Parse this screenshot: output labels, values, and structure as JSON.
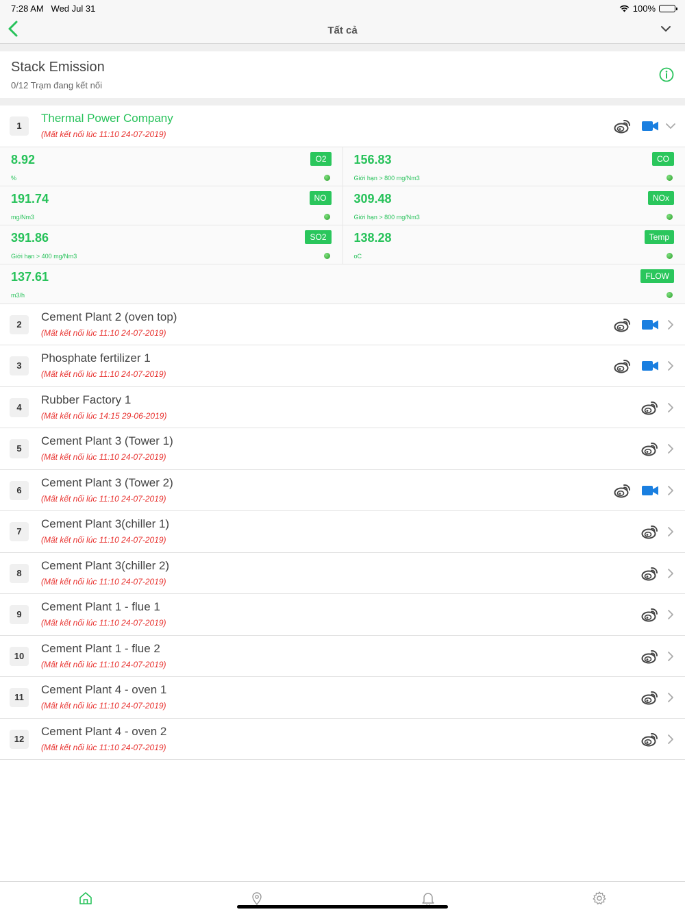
{
  "status_bar": {
    "time": "7:28 AM",
    "date": "Wed Jul 31",
    "battery": "100%"
  },
  "nav": {
    "title": "Tất cả",
    "back_icon": "chevron-left-icon",
    "dropdown_icon": "chevron-down-icon"
  },
  "header": {
    "title": "Stack Emission",
    "subtitle": "0/12 Trạm đang kết nối"
  },
  "colors": {
    "accent": "#27c25a",
    "error": "#e8322f",
    "video": "#1a7fe0"
  },
  "stations": [
    {
      "num": "1",
      "name": "Thermal Power Company",
      "status": "(Mất kết nối lúc  11:10 24-07-2019)",
      "camera": true,
      "expanded": true
    },
    {
      "num": "2",
      "name": "Cement Plant 2 (oven top)",
      "status": "(Mất kết nối lúc  11:10 24-07-2019)",
      "camera": true
    },
    {
      "num": "3",
      "name": "Phosphate fertilizer 1",
      "status": "(Mất kết nối lúc  11:10 24-07-2019)",
      "camera": true
    },
    {
      "num": "4",
      "name": "Rubber Factory 1",
      "status": "(Mất kết nối lúc  14:15 29-06-2019)",
      "camera": false
    },
    {
      "num": "5",
      "name": "Cement Plant 3 (Tower 1)",
      "status": "(Mất kết nối lúc  11:10 24-07-2019)",
      "camera": false
    },
    {
      "num": "6",
      "name": "Cement Plant 3 (Tower 2)",
      "status": "(Mất kết nối lúc  11:10 24-07-2019)",
      "camera": true
    },
    {
      "num": "7",
      "name": "Cement Plant 3(chiller 1)",
      "status": "(Mất kết nối lúc  11:10 24-07-2019)",
      "camera": false
    },
    {
      "num": "8",
      "name": "Cement Plant 3(chiller 2)",
      "status": "(Mất kết nối lúc  11:10 24-07-2019)",
      "camera": false
    },
    {
      "num": "9",
      "name": "Cement Plant 1 - flue 1",
      "status": "(Mất kết nối lúc  11:10 24-07-2019)",
      "camera": false
    },
    {
      "num": "10",
      "name": "Cement Plant 1 - flue 2",
      "status": "(Mất kết nối lúc  11:10 24-07-2019)",
      "camera": false
    },
    {
      "num": "11",
      "name": "Cement Plant 4 - oven 1",
      "status": "(Mất kết nối lúc  11:10 24-07-2019)",
      "camera": false
    },
    {
      "num": "12",
      "name": "Cement Plant 4 - oven 2",
      "status": "(Mất kết nối lúc  11:10 24-07-2019)",
      "camera": false
    }
  ],
  "metrics": [
    {
      "value": "8.92",
      "unit": "%",
      "tag": "O2"
    },
    {
      "value": "156.83",
      "unit": "Giới hạn > 800 mg/Nm3",
      "tag": "CO"
    },
    {
      "value": "191.74",
      "unit": "mg/Nm3",
      "tag": "NO"
    },
    {
      "value": "309.48",
      "unit": "Giới hạn > 800 mg/Nm3",
      "tag": "NOx"
    },
    {
      "value": "391.86",
      "unit": "Giới hạn > 400 mg/Nm3",
      "tag": "SO2"
    },
    {
      "value": "138.28",
      "unit": "oC",
      "tag": "Temp"
    },
    {
      "value": "137.61",
      "unit": "m3/h",
      "tag": "FLOW"
    }
  ],
  "tabs": [
    {
      "icon": "home-icon",
      "active": true
    },
    {
      "icon": "map-pin-icon",
      "active": false
    },
    {
      "icon": "bell-icon",
      "active": false
    },
    {
      "icon": "gear-icon",
      "active": false
    }
  ]
}
